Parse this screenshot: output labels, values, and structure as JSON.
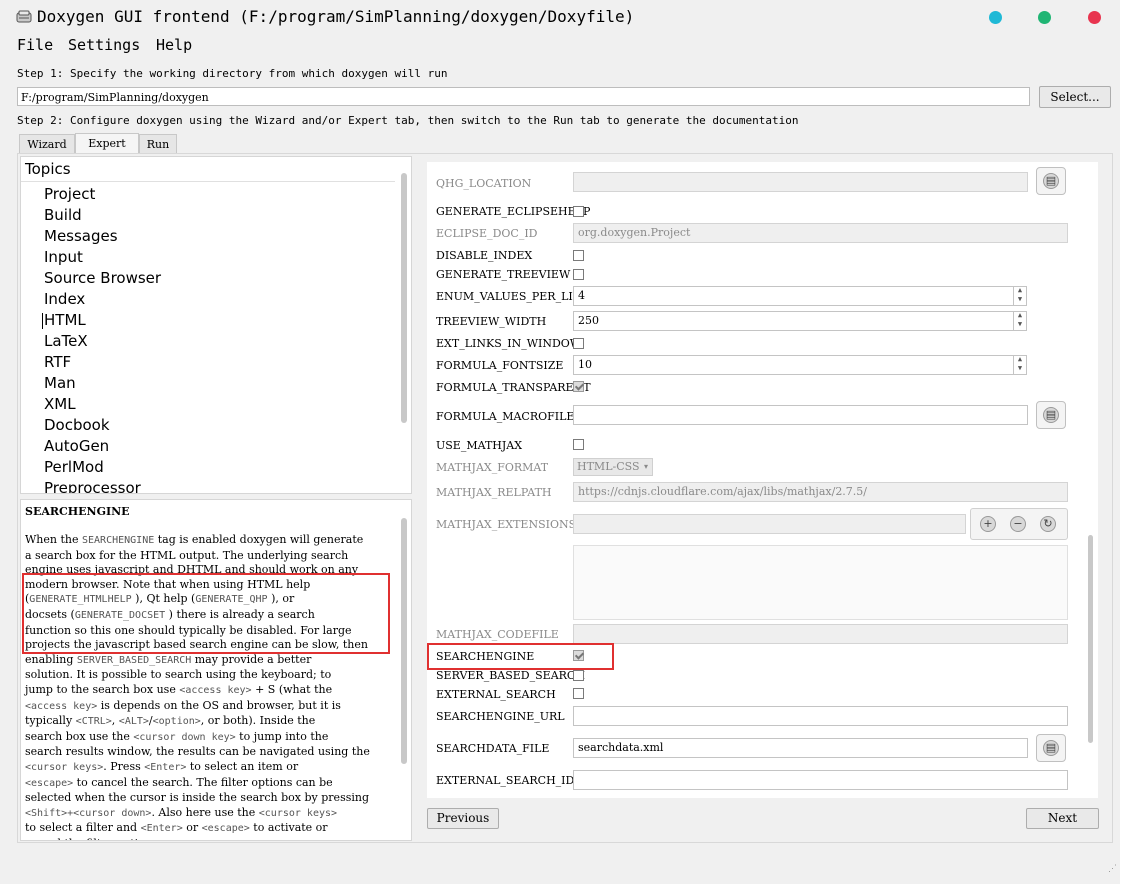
{
  "window": {
    "title": "Doxygen GUI frontend (F:/program/SimPlanning/doxygen/Doxyfile)",
    "controls": {
      "min_color": "#1fb9d6",
      "max_color": "#20b574",
      "close_color": "#e8344f"
    }
  },
  "menu": {
    "file": "File",
    "settings": "Settings",
    "help": "Help"
  },
  "step1": {
    "label": "Step 1: Specify the working directory from which doxygen will run",
    "path": "F:/program/SimPlanning/doxygen",
    "select_button": "Select..."
  },
  "step2": {
    "label": "Step 2: Configure doxygen using the Wizard and/or Expert tab, then switch to the Run tab to generate the documentation"
  },
  "tabs": [
    "Wizard",
    "Expert",
    "Run"
  ],
  "active_tab": "Expert",
  "topics": {
    "header": "Topics",
    "items": [
      "Project",
      "Build",
      "Messages",
      "Input",
      "Source Browser",
      "Index",
      "HTML",
      "LaTeX",
      "RTF",
      "Man",
      "XML",
      "Docbook",
      "AutoGen",
      "PerlMod",
      "Preprocessor"
    ],
    "selected": "HTML"
  },
  "help": {
    "title": "SEARCHENGINE",
    "lines": [
      [
        "When the ",
        "SEARCHENGINE",
        " tag is enabled doxygen will generate"
      ],
      [
        "a search box for the HTML output. The underlying search"
      ],
      [
        "engine uses javascript and DHTML and should work on any"
      ],
      [
        "modern browser. Note that when using HTML help"
      ],
      [
        "(",
        "GENERATE_HTMLHELP",
        " ), Qt help (",
        "GENERATE_QHP",
        " ), or"
      ],
      [
        "docsets (",
        "GENERATE_DOCSET",
        " ) there is already a search"
      ],
      [
        "function so this one should typically be disabled. For large"
      ],
      [
        "projects the javascript based search engine can be slow, then"
      ],
      [
        "enabling ",
        "SERVER_BASED_SEARCH",
        " may provide a better"
      ],
      [
        "solution. It is possible to search using the keyboard; to"
      ],
      [
        "jump to the search box use ",
        "<access key>",
        " + S (what the"
      ],
      [
        "",
        "<access key>",
        " is depends on the OS and browser, but it is"
      ],
      [
        "typically ",
        "<CTRL>",
        ", ",
        "<ALT>",
        "/",
        "<option>",
        ", or both). Inside the"
      ],
      [
        "search box use the ",
        "<cursor down key>",
        " to jump into the"
      ],
      [
        "search results window, the results can be navigated using the"
      ],
      [
        "",
        "<cursor keys>",
        ". Press ",
        "<Enter>",
        " to select an item or"
      ],
      [
        "",
        "<escape>",
        " to cancel the search. The filter options can be"
      ],
      [
        "selected when the cursor is inside the search box by pressing"
      ],
      [
        "",
        "<Shift>+<cursor down>",
        ". Also here use the ",
        "<cursor keys>",
        ""
      ],
      [
        "to select a filter and ",
        "<Enter>",
        " or ",
        "<escape>",
        " to activate or"
      ],
      [
        "cancel the filter option."
      ]
    ]
  },
  "settings": {
    "qhg_location": {
      "label": "QHG_LOCATION",
      "value": ""
    },
    "generate_eclipsehelp": {
      "label": "GENERATE_ECLIPSEHELP",
      "checked": false
    },
    "eclipse_doc_id": {
      "label": "ECLIPSE_DOC_ID",
      "value": "org.doxygen.Project"
    },
    "disable_index": {
      "label": "DISABLE_INDEX",
      "checked": false
    },
    "generate_treeview": {
      "label": "GENERATE_TREEVIEW",
      "checked": false
    },
    "enum_values_per_line": {
      "label": "ENUM_VALUES_PER_LINE",
      "value": "4"
    },
    "treeview_width": {
      "label": "TREEVIEW_WIDTH",
      "value": "250"
    },
    "ext_links_in_window": {
      "label": "EXT_LINKS_IN_WINDOW",
      "checked": false
    },
    "formula_fontsize": {
      "label": "FORMULA_FONTSIZE",
      "value": "10"
    },
    "formula_transparent": {
      "label": "FORMULA_TRANSPARENT",
      "checked": true
    },
    "formula_macrofile": {
      "label": "FORMULA_MACROFILE",
      "value": ""
    },
    "use_mathjax": {
      "label": "USE_MATHJAX",
      "checked": false
    },
    "mathjax_format": {
      "label": "MATHJAX_FORMAT",
      "value": "HTML-CSS"
    },
    "mathjax_relpath": {
      "label": "MATHJAX_RELPATH",
      "value": "https://cdnjs.cloudflare.com/ajax/libs/mathjax/2.7.5/"
    },
    "mathjax_extensions": {
      "label": "MATHJAX_EXTENSIONS",
      "value": ""
    },
    "mathjax_codefile": {
      "label": "MATHJAX_CODEFILE",
      "value": ""
    },
    "searchengine": {
      "label": "SEARCHENGINE",
      "checked": true
    },
    "server_based_search": {
      "label": "SERVER_BASED_SEARCH",
      "checked": false
    },
    "external_search": {
      "label": "EXTERNAL_SEARCH",
      "checked": false
    },
    "searchengine_url": {
      "label": "SEARCHENGINE_URL",
      "value": ""
    },
    "searchdata_file": {
      "label": "SEARCHDATA_FILE",
      "value": "searchdata.xml"
    },
    "external_search_id": {
      "label": "EXTERNAL_SEARCH_ID",
      "value": ""
    }
  },
  "nav": {
    "previous": "Previous",
    "next": "Next"
  },
  "highlight_color": "#e03030"
}
